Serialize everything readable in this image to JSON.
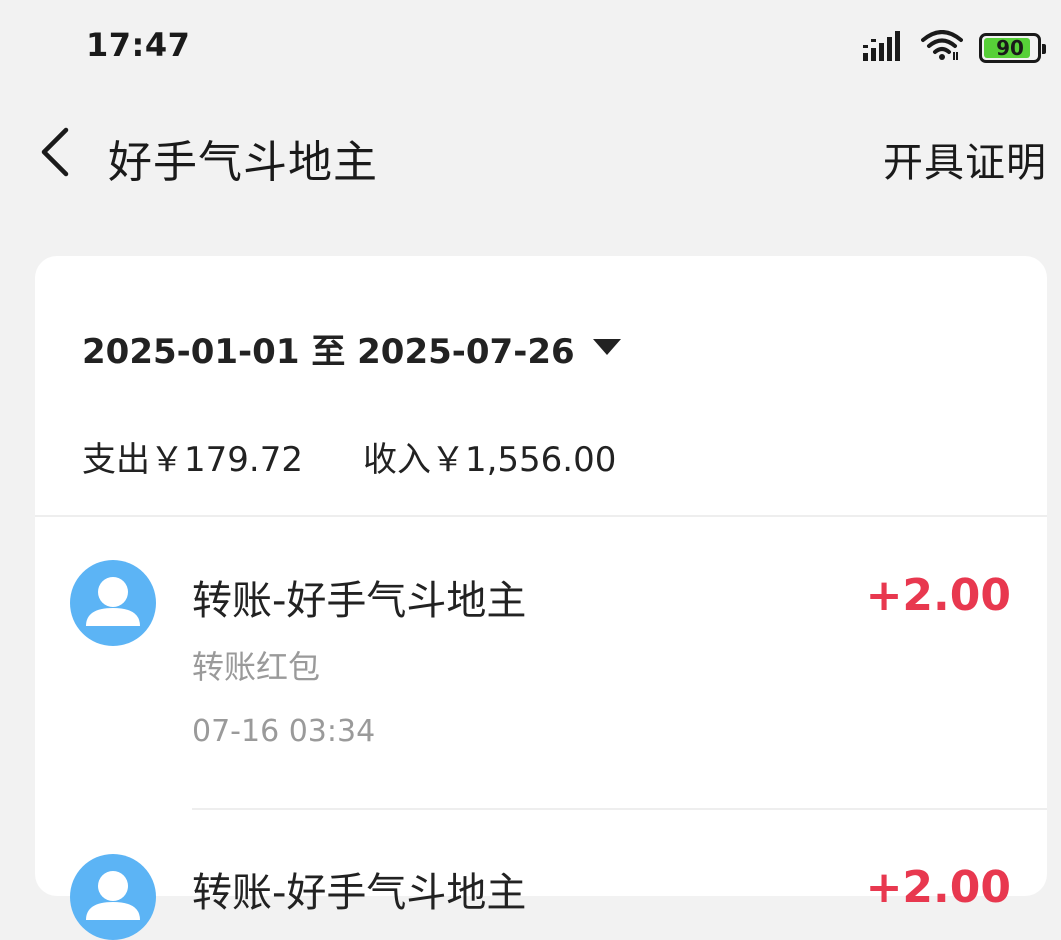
{
  "status_bar": {
    "time": "17:47",
    "battery": "90",
    "battery_level": 0.9,
    "icons": [
      "signal-icon",
      "wifi-icon",
      "battery-icon"
    ]
  },
  "nav": {
    "back_icon": "chevron-left-icon",
    "title": "好手气斗地主",
    "action": "开具证明"
  },
  "filter": {
    "date_range": "2025-01-01 至 2025-07-26",
    "dropdown_icon": "caret-down-icon"
  },
  "summary": {
    "expense": "支出￥179.72",
    "income": "收入￥1,556.00"
  },
  "transactions": [
    {
      "title": "转账-好手气斗地主",
      "subtitle": "转账红包",
      "time": "07-16 03:34",
      "amount": "+2.00",
      "amount_color": "#e8384f",
      "avatar_icon": "user-avatar-icon"
    },
    {
      "title": "转账-好手气斗地主",
      "amount": "+2.00",
      "avatar_icon": "user-avatar-icon"
    }
  ],
  "colors": {
    "background": "#f2f2f2",
    "card": "#ffffff",
    "income_red": "#e8384f",
    "avatar_blue": "#5cb4f5",
    "battery_green": "#57d038"
  }
}
